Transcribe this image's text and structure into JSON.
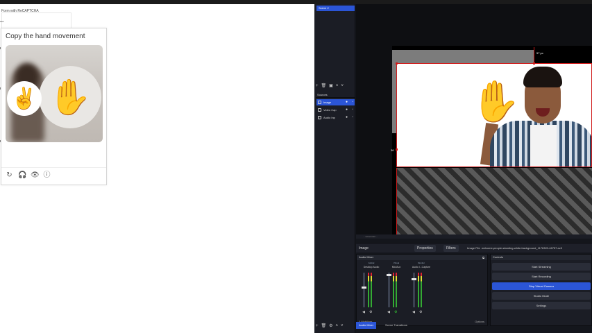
{
  "browser": {
    "form_title": "Form with ReCAPTCHA",
    "name_label": "me"
  },
  "captcha": {
    "title": "Copy the hand movement",
    "emoji": "✌️",
    "hand_glyph": "✋",
    "icons": [
      "refresh-icon",
      "headphones-icon",
      "eye-icon",
      "info-icon"
    ],
    "icon_glyphs": [
      "↻",
      "🎧",
      "👁",
      "ⓘ"
    ]
  },
  "obs": {
    "scene_name": "Scene 2",
    "sources_label": "Sources",
    "sources": [
      {
        "name": "Image",
        "active": true
      },
      {
        "name": "Video Cap",
        "active": false
      },
      {
        "name": "Audio Inp",
        "active": false
      }
    ],
    "dimension_top": "57 px",
    "dimension_left": "36",
    "status_text": "... screenshot ...",
    "properties_source": "Image",
    "properties_button": "Properties",
    "filters_button": "Filters",
    "image_file_label": "Image File",
    "image_file_value": "welcome-people-standing-white-background_1176320-46757.avif",
    "audio_mixer": {
      "title": "Audio Mixer",
      "channels": [
        {
          "name": "Desktop Audio",
          "level": "-21.1 dB",
          "tag": "Global"
        },
        {
          "name": "Mic/Aux",
          "level": "-0.1 dB",
          "tag": "Virtual"
        },
        {
          "name": "Audio I...Capture",
          "level": "-1.0 dB",
          "tag": "Monitor"
        }
      ],
      "footer": "0 Mobilium",
      "options": "Options"
    },
    "controls": {
      "title": "Controls",
      "buttons": [
        {
          "label": "Start Streaming",
          "active": false
        },
        {
          "label": "Start Recording",
          "active": false
        },
        {
          "label": "Stop Virtual Camera",
          "active": true
        },
        {
          "label": "Studio Mode",
          "active": false
        },
        {
          "label": "Settings",
          "active": false
        }
      ]
    },
    "dock_tabs": [
      {
        "label": "Audio Mixer",
        "active": true
      },
      {
        "label": "Scene Transitions",
        "active": false
      }
    ],
    "accent_color": "#2b55d6"
  }
}
